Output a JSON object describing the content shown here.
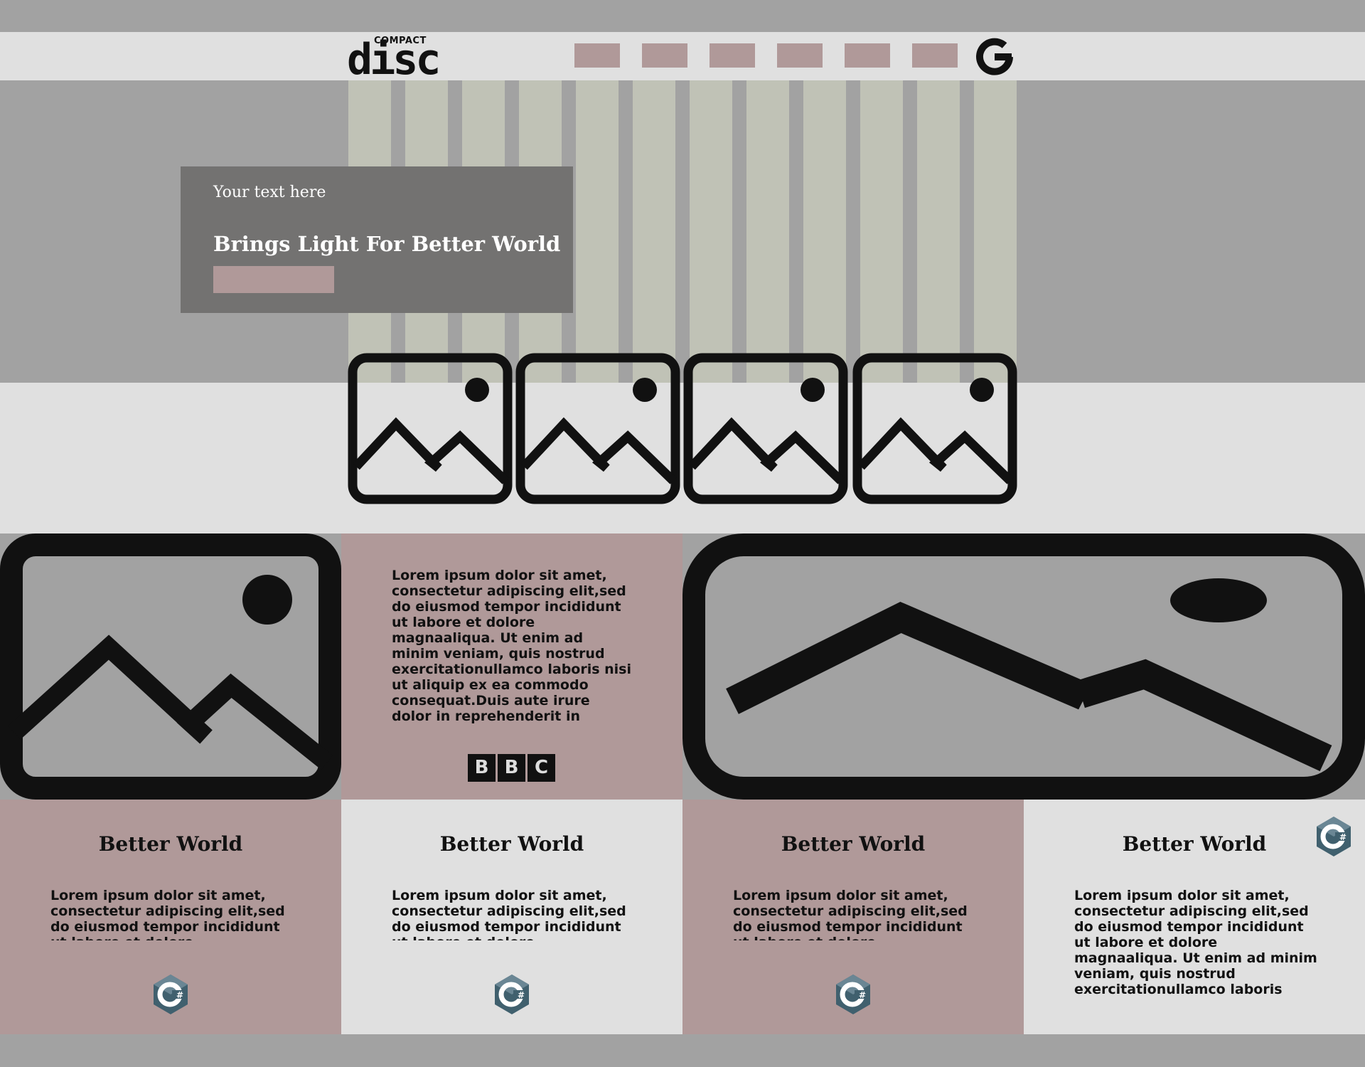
{
  "header": {
    "logo": {
      "small_text": "COMPACT",
      "big_text": "disc"
    },
    "nav_items": [
      "",
      "",
      "",
      "",
      "",
      ""
    ],
    "brand_icon": "google-g-icon"
  },
  "hero": {
    "eyebrow": "Your text here",
    "title": "Brings Light For Better World",
    "button_label": ""
  },
  "thumbnails": [
    "image-placeholder-icon",
    "image-placeholder-icon",
    "image-placeholder-icon",
    "image-placeholder-icon"
  ],
  "feature": {
    "text": "Lorem ipsum dolor sit amet, consectetur adipiscing elit,sed do eiusmod tempor incididunt ut labore et dolore magnaaliqua. Ut enim ad minim veniam, quis nostrud exercitationullamco laboris nisi ut aliquip ex ea commodo consequat.Duis aute irure dolor in reprehenderit in",
    "badge_letters": [
      "B",
      "B",
      "C"
    ]
  },
  "cards": [
    {
      "title": "Better World",
      "body": "Lorem ipsum dolor sit amet, consectetur adipiscing elit,sed do eiusmod tempor incididunt ut labore et dolore"
    },
    {
      "title": "Better World",
      "body": "Lorem ipsum dolor sit amet, consectetur adipiscing elit,sed do eiusmod tempor incididunt ut labore et dolore"
    },
    {
      "title": "Better World",
      "body": "Lorem ipsum dolor sit amet, consectetur adipiscing elit,sed do eiusmod tempor incididunt ut labore et dolore"
    },
    {
      "title": "Better World",
      "body": "Lorem ipsum dolor sit amet, consectetur adipiscing elit,sed do eiusmod tempor incididunt ut labore et dolore magnaaliqua. Ut enim ad minim veniam, quis nostrud exercitationullamco laboris"
    }
  ],
  "colors": {
    "page_bg": "#a2a2a2",
    "band_bg": "#e0e0e0",
    "accent_mauve": "#b09999",
    "hero_panel": "#737271",
    "stripe": "#c0c2b6"
  }
}
